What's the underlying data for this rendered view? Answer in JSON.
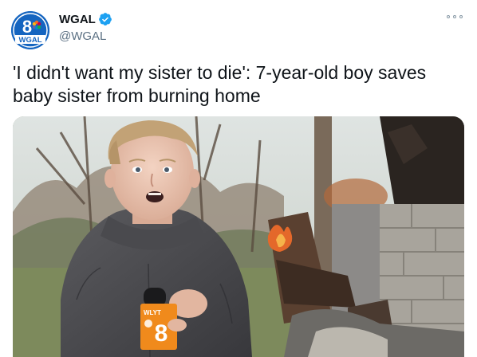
{
  "account": {
    "display_name": "WGAL",
    "handle": "@WGAL",
    "verified": true,
    "avatar_logo_number": "8",
    "avatar_logo_text": "WGAL",
    "avatar_color": "#1565c0"
  },
  "tweet": {
    "text": "'I didn't want my sister to die': 7-year-old boy saves baby sister from burning home"
  },
  "media": {
    "mic_flag_text": "WLYT",
    "mic_flag_number": "8",
    "mic_flag_color": "#f08a1c"
  },
  "icons": {
    "verified": "verified-badge-icon",
    "more": "more-options-icon"
  }
}
